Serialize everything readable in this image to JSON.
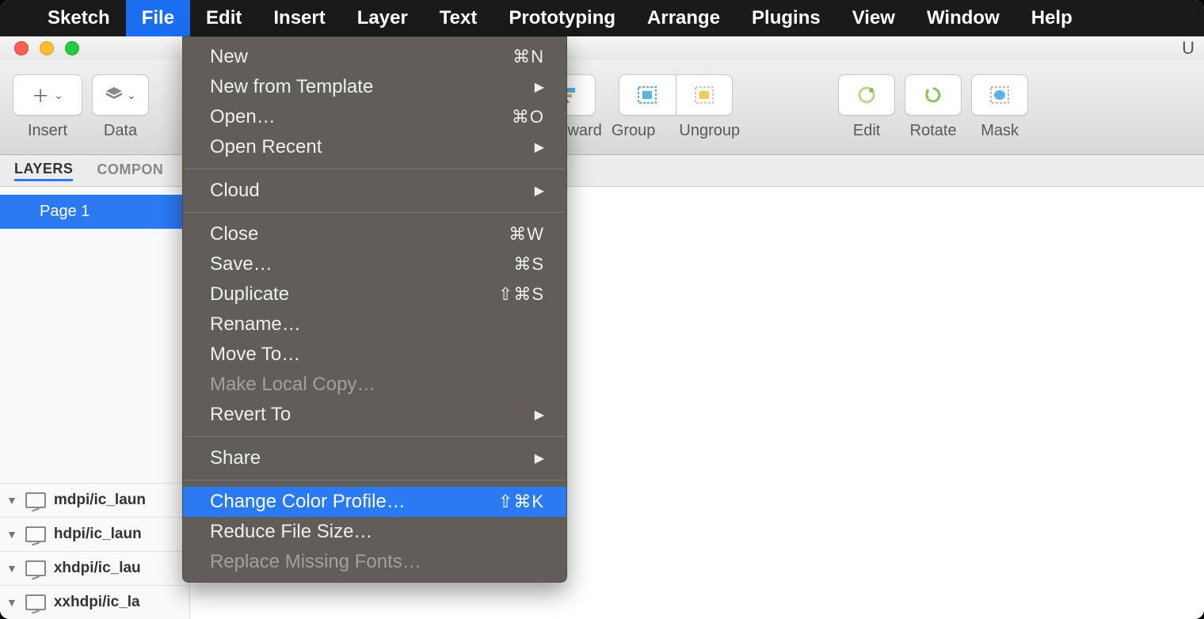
{
  "menubar": {
    "app_name": "Sketch",
    "items": [
      "File",
      "Edit",
      "Insert",
      "Layer",
      "Text",
      "Prototyping",
      "Arrange",
      "Plugins",
      "View",
      "Window",
      "Help"
    ],
    "active_index": 0
  },
  "window": {
    "title_right": "U"
  },
  "toolbar": {
    "insert_label": "Insert",
    "data_label": "Data",
    "backward_label": "Backward",
    "group_label": "Group",
    "ungroup_label": "Ungroup",
    "edit_label": "Edit",
    "rotate_label": "Rotate",
    "mask_label": "Mask"
  },
  "tabs": {
    "layers": "LAYERS",
    "components": "COMPON"
  },
  "sidebar": {
    "page": "Page 1",
    "layers": [
      "mdpi/ic_laun",
      "hdpi/ic_laun",
      "xhdpi/ic_lau",
      "xxhdpi/ic_la"
    ]
  },
  "file_menu": {
    "items": [
      {
        "label": "New",
        "shortcut": "⌘N",
        "type": "item"
      },
      {
        "label": "New from Template",
        "type": "submenu"
      },
      {
        "label": "Open…",
        "shortcut": "⌘O",
        "type": "item"
      },
      {
        "label": "Open Recent",
        "type": "submenu"
      },
      {
        "type": "sep"
      },
      {
        "label": "Cloud",
        "type": "submenu"
      },
      {
        "type": "sep"
      },
      {
        "label": "Close",
        "shortcut": "⌘W",
        "type": "item"
      },
      {
        "label": "Save…",
        "shortcut": "⌘S",
        "type": "item"
      },
      {
        "label": "Duplicate",
        "shortcut": "⇧⌘S",
        "type": "item"
      },
      {
        "label": "Rename…",
        "type": "item"
      },
      {
        "label": "Move To…",
        "type": "item"
      },
      {
        "label": "Make Local Copy…",
        "type": "item",
        "disabled": true
      },
      {
        "label": "Revert To",
        "type": "submenu"
      },
      {
        "type": "sep"
      },
      {
        "label": "Share",
        "type": "submenu"
      },
      {
        "type": "sep"
      },
      {
        "label": "Change Color Profile…",
        "shortcut": "⇧⌘K",
        "type": "item",
        "highlighted": true
      },
      {
        "label": "Reduce File Size…",
        "type": "item"
      },
      {
        "label": "Replace Missing Fonts…",
        "type": "item",
        "disabled": true
      }
    ]
  }
}
